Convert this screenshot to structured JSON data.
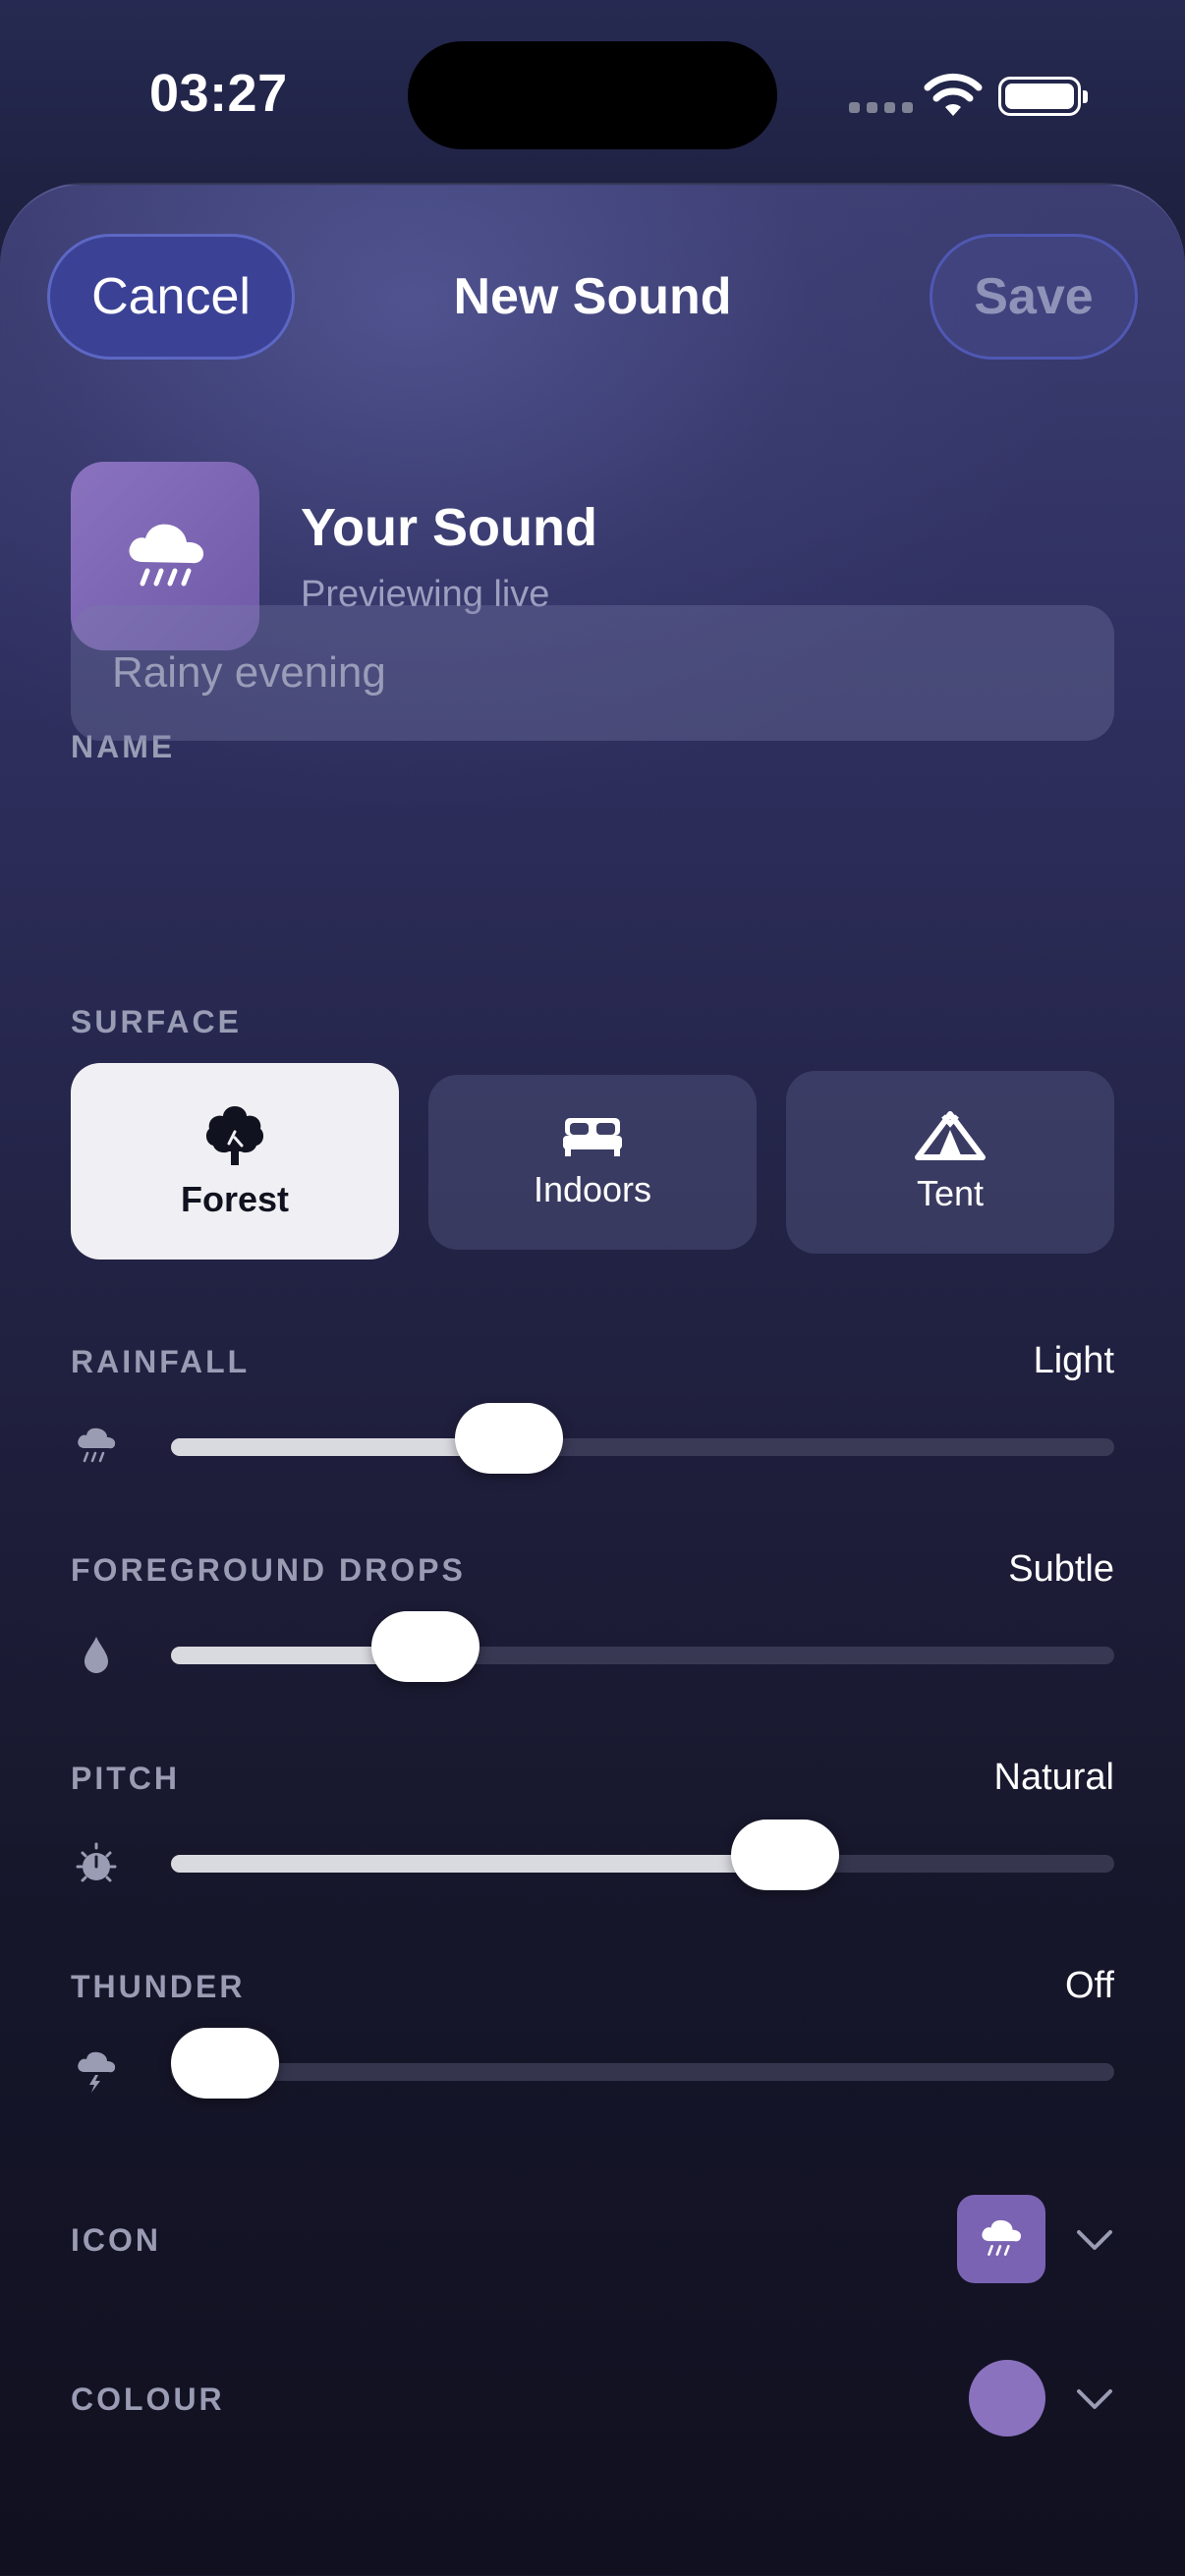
{
  "status_bar": {
    "time": "03:27"
  },
  "header": {
    "cancel_label": "Cancel",
    "title": "New Sound",
    "save_label": "Save"
  },
  "preview": {
    "title": "Your Sound",
    "subtitle": "Previewing live",
    "icon": "cloud-rain-icon"
  },
  "name_section": {
    "label": "NAME",
    "placeholder": "Rainy evening",
    "value": ""
  },
  "surface_section": {
    "label": "SURFACE",
    "options": [
      {
        "label": "Forest",
        "icon": "tree-icon",
        "selected": true
      },
      {
        "label": "Indoors",
        "icon": "bed-icon",
        "selected": false
      },
      {
        "label": "Tent",
        "icon": "tent-icon",
        "selected": false
      }
    ]
  },
  "sliders": [
    {
      "label": "RAINFALL",
      "value_text": "Light",
      "icon": "cloud-rain-icon",
      "level": 0.34
    },
    {
      "label": "FOREGROUND DROPS",
      "value_text": "Subtle",
      "icon": "drop-icon",
      "level": 0.24
    },
    {
      "label": "PITCH",
      "value_text": "Natural",
      "icon": "dial-icon",
      "level": 0.67
    },
    {
      "label": "THUNDER",
      "value_text": "Off",
      "icon": "cloud-bolt-icon",
      "level": 0.0
    }
  ],
  "icon_row": {
    "label": "ICON",
    "selected_icon": "cloud-rain-icon"
  },
  "colour_row": {
    "label": "COLOUR",
    "selected_color": "#8a72bf"
  },
  "colors": {
    "accent": "#3b4296",
    "icon_tile": "#7a63b3",
    "selected_surface": "#f0f0f4"
  }
}
